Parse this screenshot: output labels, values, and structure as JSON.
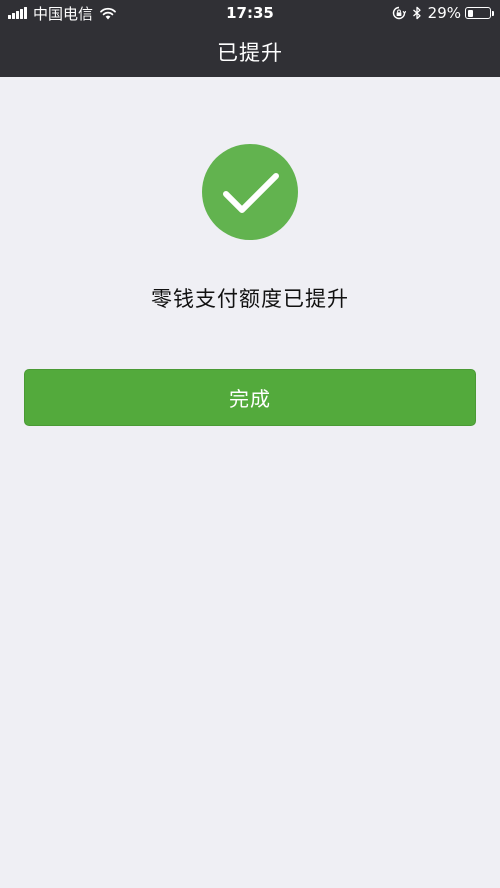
{
  "status_bar": {
    "carrier": "中国电信",
    "time": "17:35",
    "battery_percent": "29%",
    "battery_level": 0.29,
    "icons": [
      "signal-icon",
      "wifi-icon",
      "orientation-lock-icon",
      "bluetooth-icon",
      "battery-icon"
    ]
  },
  "nav": {
    "title": "已提升"
  },
  "result": {
    "icon": "check-icon",
    "message": "零钱支付额度已提升"
  },
  "actions": {
    "done_label": "完成"
  },
  "colors": {
    "header_bg": "#303035",
    "page_bg": "#efeff4",
    "success_green": "#62b34f",
    "button_green": "#53aa3c"
  }
}
